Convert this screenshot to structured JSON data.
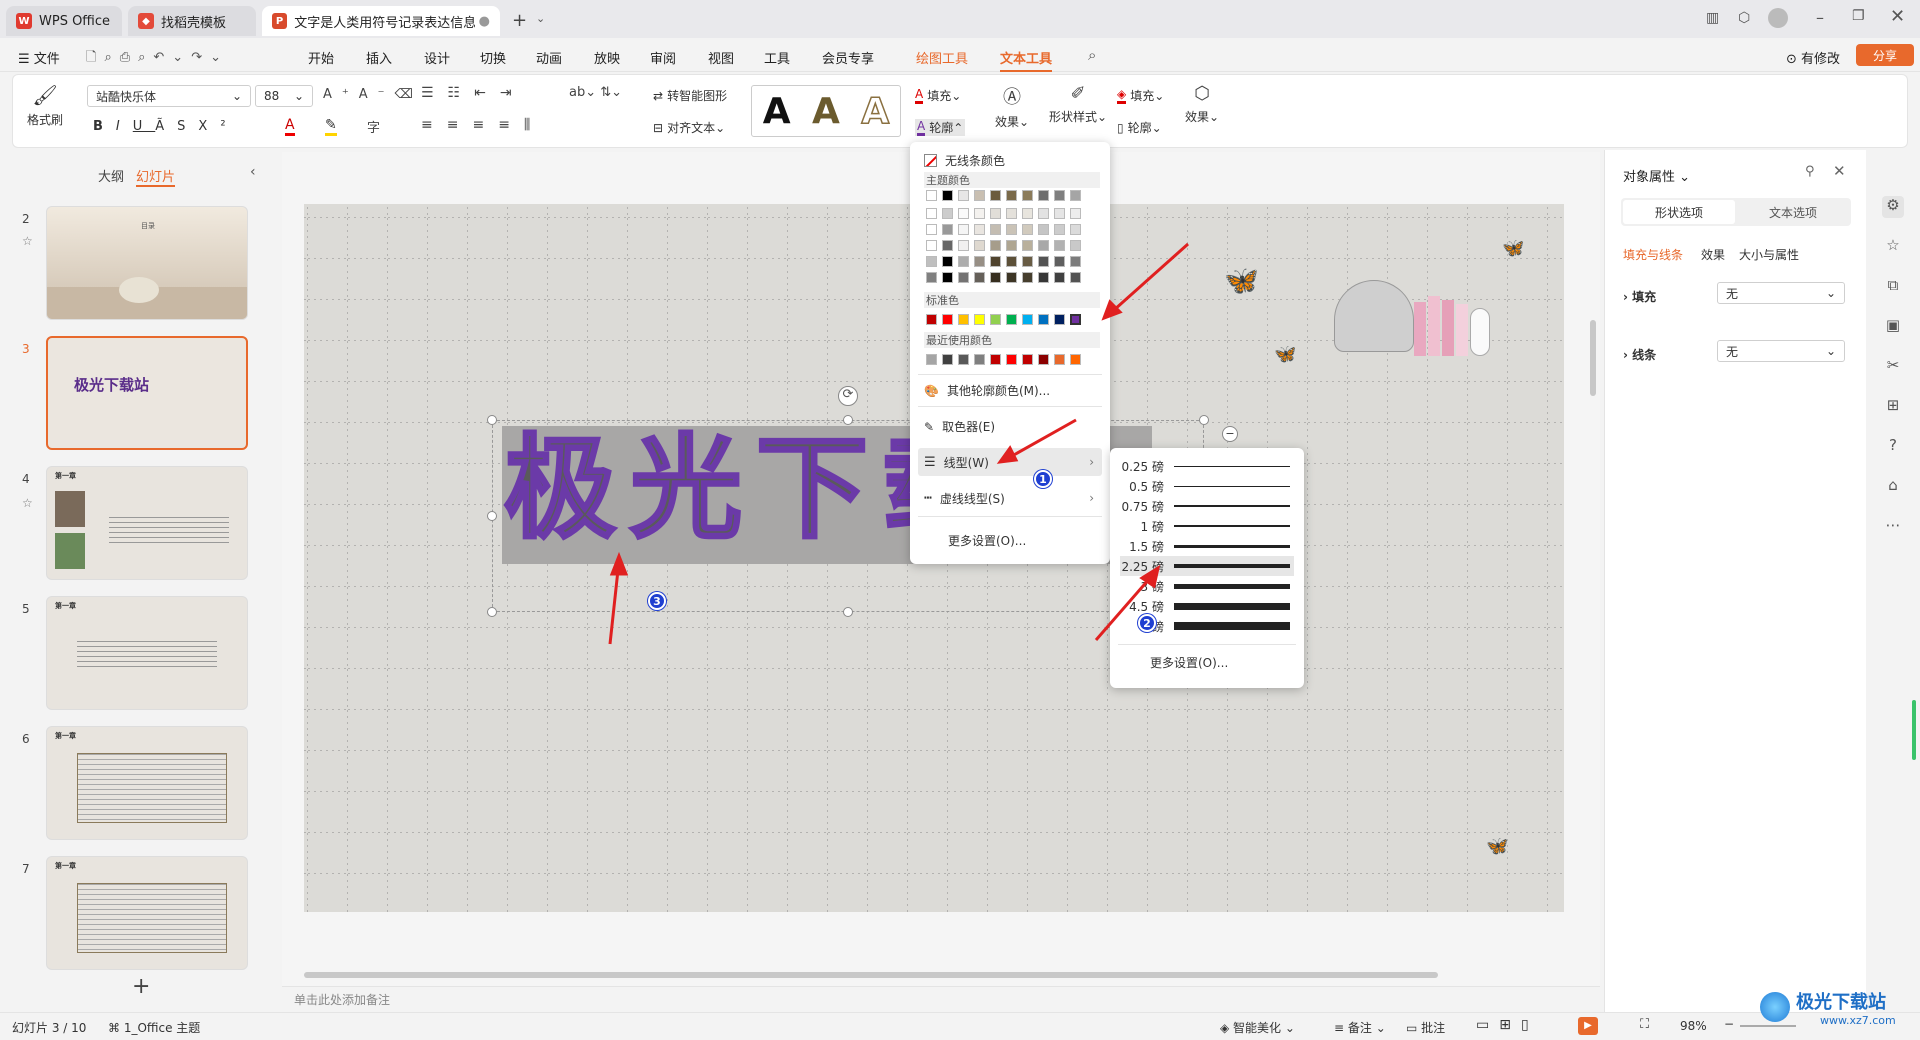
{
  "tabs": [
    {
      "label": "WPS Office"
    },
    {
      "label": "找稻壳模板"
    },
    {
      "label": "文字是人类用符号记录表达信息以"
    }
  ],
  "menu": {
    "file": "文件",
    "items": [
      "开始",
      "插入",
      "设计",
      "切换",
      "动画",
      "放映",
      "审阅",
      "视图",
      "工具",
      "会员专享",
      "绘图工具",
      "文本工具"
    ],
    "active": "文本工具",
    "right_edit": "有修改",
    "share": "分享"
  },
  "ribbon": {
    "format_painter": "格式刷",
    "font_name": "站酷快乐体",
    "font_size": "88",
    "smart_shape": "转智能图形",
    "align_text": "对齐文本",
    "fill": "填充",
    "outline": "轮廓",
    "effect": "效果",
    "shape_style": "形状样式",
    "shape_fill": "填充",
    "shape_outline": "轮廓",
    "shape_effect": "效果",
    "style_letter": "A"
  },
  "left_panel": {
    "tab_outline": "大纲",
    "tab_slides": "幻灯片",
    "slides": [
      {
        "num": "2",
        "title": "目录"
      },
      {
        "num": "3",
        "title": "极光下载站"
      },
      {
        "num": "4",
        "title": "第一章"
      },
      {
        "num": "5",
        "title": "第一章"
      },
      {
        "num": "6",
        "title": "第一章"
      },
      {
        "num": "7",
        "title": "第一章"
      }
    ],
    "add": "+"
  },
  "slide": {
    "title_text": "极光下载",
    "notes_placeholder": "单击此处添加备注"
  },
  "color_menu": {
    "no_line": "无线条颜色",
    "theme_colors": "主题颜色",
    "standard_colors": "标准色",
    "recent_colors": "最近使用颜色",
    "more_colors": "其他轮廓颜色(M)...",
    "eyedropper": "取色器(E)",
    "line_type": "线型(W)",
    "dash_type": "虚线线型(S)",
    "more_settings": "更多设置(O)...",
    "theme_row": [
      "#ffffff",
      "#000000",
      "#e7e6e6",
      "#c9bfb1",
      "#6b5b3e",
      "#7a6a4a",
      "#8b7b5a",
      "#6e6e6e",
      "#7f7f7f",
      "#a5a5a5"
    ],
    "standard_row": [
      "#c00000",
      "#ff0000",
      "#ffc000",
      "#ffff00",
      "#92d050",
      "#00b050",
      "#00b0f0",
      "#0070c0",
      "#002060",
      "#7030a0"
    ],
    "recent_row": [
      "#a5a5a5",
      "#404040",
      "#595959",
      "#7f7f7f",
      "#c00000",
      "#ff0000",
      "#c00000",
      "#8b0000",
      "#e8692c",
      "#ff6600"
    ]
  },
  "line_menu": {
    "weights": [
      "0.25 磅",
      "0.5 磅",
      "0.75 磅",
      "1 磅",
      "1.5 磅",
      "2.25 磅",
      "3 磅",
      "4.5 磅",
      "6 磅"
    ],
    "selected": "2.25 磅",
    "more_settings": "更多设置(O)..."
  },
  "badges": [
    "1",
    "2",
    "3"
  ],
  "right_panel": {
    "title": "对象属性",
    "tab_shape": "形状选项",
    "tab_text": "文本选项",
    "sub_fill_line": "填充与线条",
    "sub_effect": "效果",
    "sub_size": "大小与属性",
    "fill_label": "填充",
    "fill_value": "无",
    "line_label": "线条",
    "line_value": "无"
  },
  "status": {
    "slide_count": "幻灯片 3 / 10",
    "theme": "1_Office 主题",
    "beautify": "智能美化",
    "notes": "备注",
    "comment": "批注",
    "zoom": "98%",
    "watermark": "极光下载站",
    "watermark_url": "www.xz7.com"
  }
}
